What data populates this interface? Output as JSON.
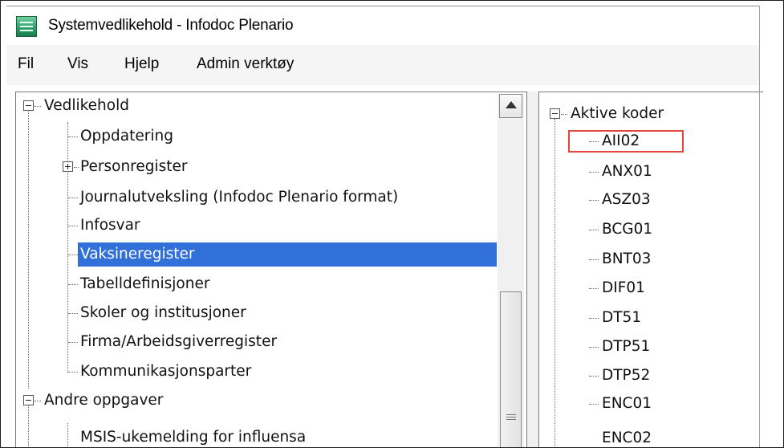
{
  "window": {
    "title": "Systemvedlikehold - Infodoc Plenario",
    "icon": "app-icon"
  },
  "menu": [
    {
      "label": "Fil"
    },
    {
      "label": "Vis"
    },
    {
      "label": "Hjelp"
    },
    {
      "label": "Admin verktøy"
    }
  ],
  "left_tree": {
    "root1": "Vedlikehold",
    "items": [
      "Oppdatering",
      "Personregister",
      "Journalutveksling (Infodoc Plenario format)",
      "Infosvar",
      "Vaksineregister",
      "Tabelldefinisjoner",
      "Skoler og institusjoner",
      "Firma/Arbeidsgiverregister",
      "Kommunikasjonsparter"
    ],
    "selected": "Vaksineregister",
    "root2": "Andre oppgaver",
    "root2_child": "MSIS-ukemelding for influensa"
  },
  "right_tree": {
    "root": "Aktive koder",
    "codes": [
      "AII02",
      "ANX01",
      "ASZ03",
      "BCG01",
      "BNT03",
      "DIF01",
      "DT51",
      "DTP51",
      "DTP52",
      "ENC01",
      "ENC02"
    ],
    "highlighted": "AII02",
    "highlight_color": "#e0483f"
  },
  "colors": {
    "selection": "#3170d8"
  }
}
